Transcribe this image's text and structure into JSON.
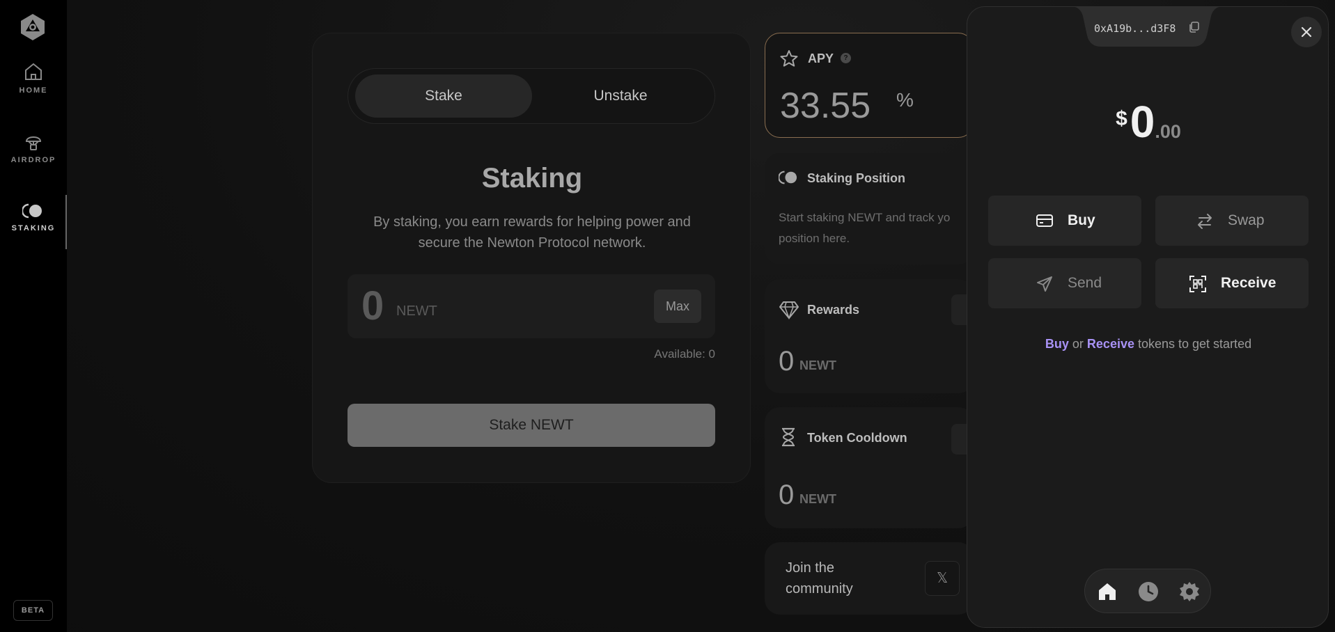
{
  "sidebar": {
    "items": [
      {
        "label": "HOME",
        "icon": "home-icon"
      },
      {
        "label": "AIRDROP",
        "icon": "airdrop-icon"
      },
      {
        "label": "STAKING",
        "icon": "staking-icon",
        "active": true
      }
    ],
    "badge": "BETA"
  },
  "staking": {
    "tabs": [
      {
        "label": "Stake",
        "selected": true
      },
      {
        "label": "Unstake",
        "selected": false
      }
    ],
    "title": "Staking",
    "description": "By staking, you earn rewards for helping power and secure the Newton Protocol network.",
    "amount": "0",
    "unit": "NEWT",
    "max_label": "Max",
    "available": "Available: 0",
    "submit_label": "Stake NEWT"
  },
  "apy": {
    "label": "APY",
    "help": "?",
    "value": "33.55",
    "suffix": "%"
  },
  "position": {
    "label": "Staking Position",
    "line1": "Start staking NEWT and track yo",
    "line2": "position here."
  },
  "rewards": {
    "label": "Rewards",
    "value": "0",
    "unit": "NEWT"
  },
  "cooldown": {
    "label": "Token Cooldown",
    "value": "0",
    "unit": "NEWT"
  },
  "community": {
    "line1": "Join the",
    "line2": "community",
    "x_label": "𝕏"
  },
  "wallet": {
    "address": "0xA19b...d3F8",
    "balance_symbol": "$",
    "balance_int": "0",
    "balance_dec": ".00",
    "actions": {
      "buy": "Buy",
      "swap": "Swap",
      "send": "Send",
      "receive": "Receive"
    },
    "hint_buy": "Buy",
    "hint_or": " or ",
    "hint_receive": "Receive",
    "hint_rest": " tokens to get started"
  },
  "colors": {
    "accent_border": "#8a6e50",
    "link": "#a892f5"
  }
}
